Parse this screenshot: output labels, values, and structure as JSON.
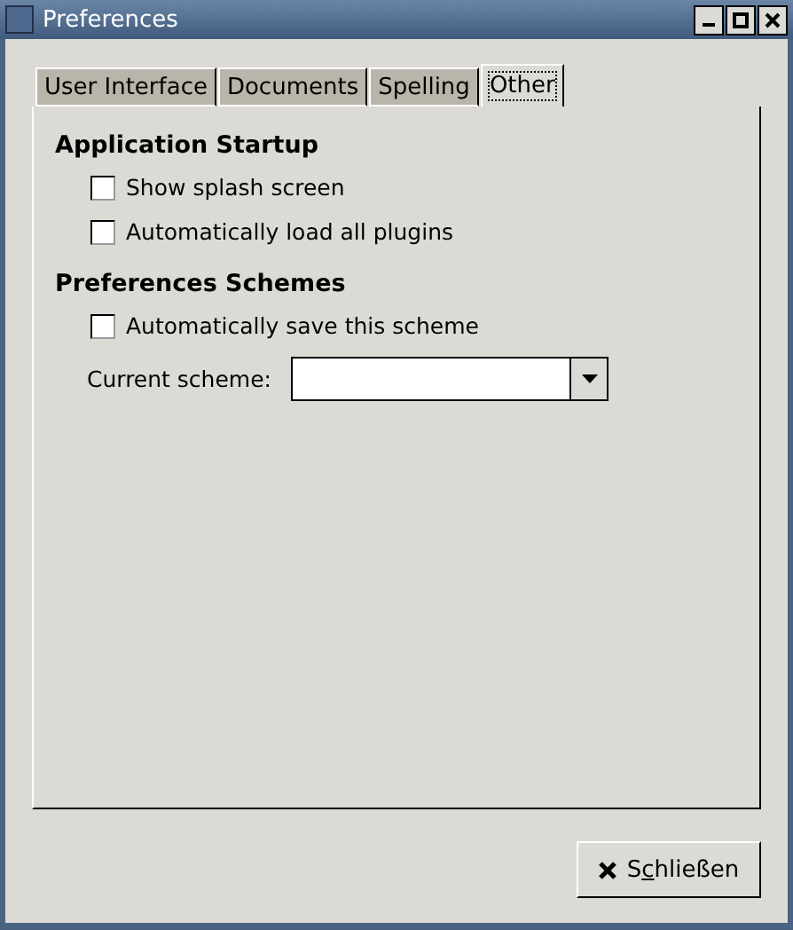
{
  "window": {
    "title": "Preferences"
  },
  "tabs": [
    {
      "label": "User Interface",
      "selected": false
    },
    {
      "label": "Documents",
      "selected": false
    },
    {
      "label": "Spelling",
      "selected": false
    },
    {
      "label": "Other",
      "selected": true
    }
  ],
  "sections": [
    {
      "heading": "Application Startup",
      "options": [
        {
          "kind": "checkbox",
          "label": "Show splash screen",
          "checked": false
        },
        {
          "kind": "checkbox",
          "label": "Automatically load all plugins",
          "checked": false
        }
      ]
    },
    {
      "heading": "Preferences Schemes",
      "options": [
        {
          "kind": "checkbox",
          "label": "Automatically save this scheme",
          "checked": false
        },
        {
          "kind": "combo",
          "label": "Current scheme:"
        }
      ]
    }
  ],
  "close_button": {
    "label_before": "S",
    "mnemonic": "c",
    "label_after": "hließen"
  }
}
